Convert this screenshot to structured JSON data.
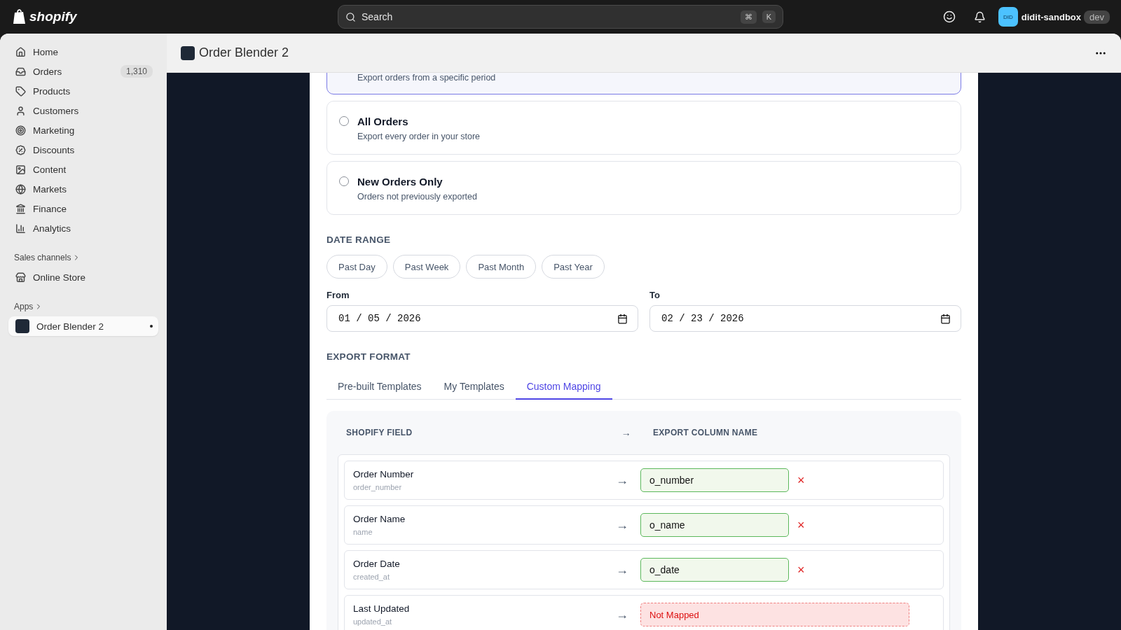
{
  "topbar": {
    "logo": "shopify",
    "search": {
      "placeholder": "Search",
      "keys": [
        "⌘",
        "K"
      ]
    },
    "store": {
      "initials": "DID",
      "name": "didit-sandbox",
      "badge": "dev"
    }
  },
  "sidebar": {
    "items": [
      {
        "label": "Home",
        "selected": false
      },
      {
        "label": "Orders",
        "badge": "1,310",
        "selected": false
      },
      {
        "label": "Products",
        "selected": false
      },
      {
        "label": "Customers",
        "selected": false
      },
      {
        "label": "Marketing",
        "selected": false
      },
      {
        "label": "Discounts",
        "selected": false
      },
      {
        "label": "Content",
        "selected": false
      },
      {
        "label": "Markets",
        "selected": false
      },
      {
        "label": "Finance",
        "selected": false
      },
      {
        "label": "Analytics",
        "selected": false
      }
    ],
    "sales_channels": {
      "heading": "Sales channels",
      "items": [
        {
          "label": "Online Store",
          "selected": false
        }
      ]
    },
    "apps": {
      "heading": "Apps",
      "items": [
        {
          "label": "Order Blender 2",
          "selected": true
        }
      ]
    }
  },
  "page": {
    "title": "Order Blender 2"
  },
  "export_options": [
    {
      "description": "Export orders from a specific period",
      "selected": true
    },
    {
      "title": "All Orders",
      "description": "Export every order in your store",
      "selected": false
    },
    {
      "title": "New Orders Only",
      "description": "Orders not previously exported",
      "selected": false
    }
  ],
  "date_range": {
    "heading": "DATE RANGE",
    "presets": [
      "Past Day",
      "Past Week",
      "Past Month",
      "Past Year"
    ],
    "from": {
      "label": "From",
      "value": "01 / 05 / 2026"
    },
    "to": {
      "label": "To",
      "value": "02 / 23 / 2026"
    }
  },
  "export_format": {
    "heading": "EXPORT FORMAT",
    "tabs": [
      {
        "label": "Pre-built Templates",
        "selected": false
      },
      {
        "label": "My Templates",
        "selected": false
      },
      {
        "label": "Custom Mapping",
        "selected": true
      }
    ]
  },
  "mapping": {
    "columns": [
      "SHOPIFY FIELD",
      "→",
      "EXPORT COLUMN NAME"
    ],
    "rows": [
      {
        "name": "Order Number",
        "field": "order_number",
        "arrow": "→",
        "kind": "mapped",
        "value": "o_number",
        "remove": "×"
      },
      {
        "name": "Order Name",
        "field": "name",
        "arrow": "→",
        "kind": "mapped",
        "value": "o_name",
        "remove": "×"
      },
      {
        "name": "Order Date",
        "field": "created_at",
        "arrow": "→",
        "kind": "mapped",
        "value": "o_date",
        "remove": "×"
      },
      {
        "name": "Last Updated",
        "field": "updated_at",
        "arrow": "→",
        "kind": "unmapped",
        "value": "Not Mapped"
      }
    ]
  }
}
